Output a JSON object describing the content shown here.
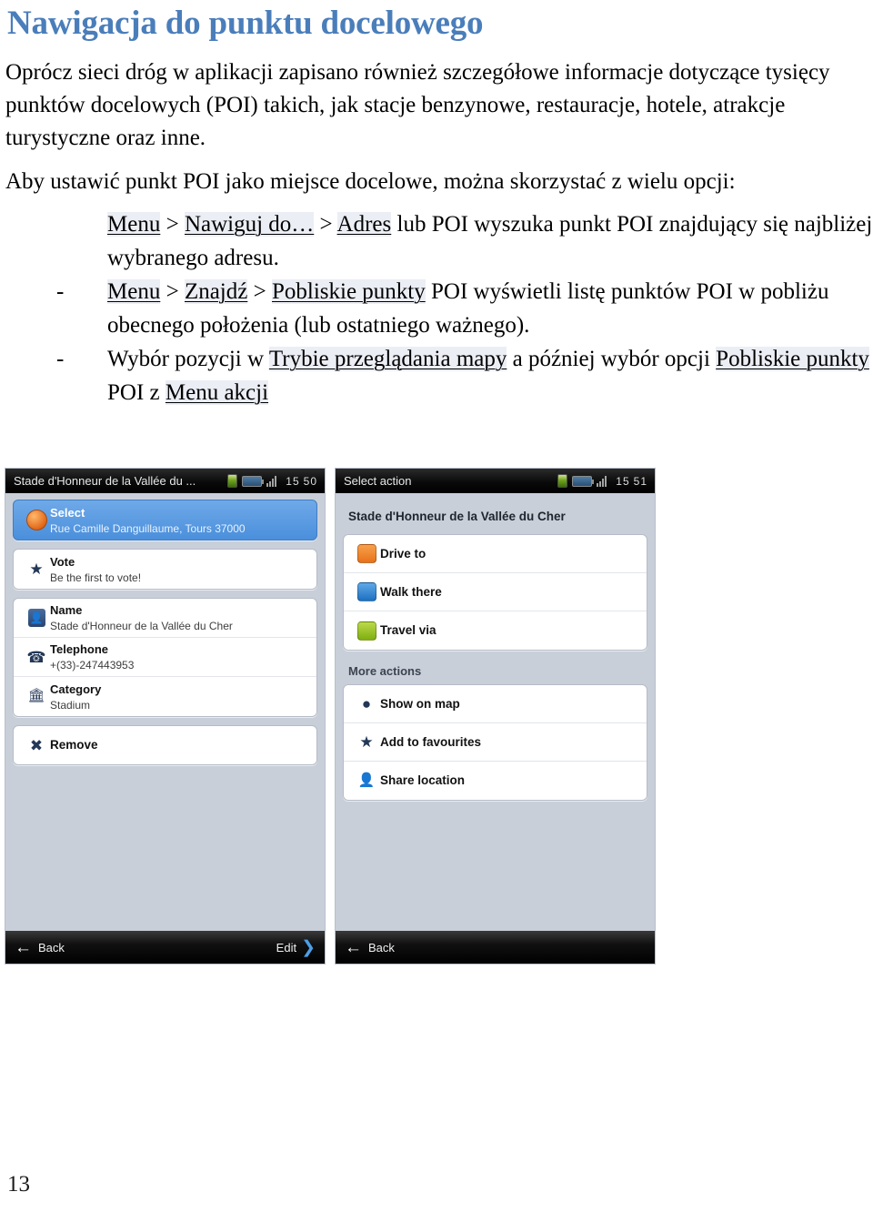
{
  "document": {
    "title": "Nawigacja do punktu docelowego",
    "title_color": "#4a7ebb",
    "paragraphs": [
      "Oprócz sieci dróg w aplikacji zapisano również szczegółowe informacje dotyczące tysięcy punktów docelowych (POI) takich, jak stacje benzynowe, restauracje, hotele, atrakcje turystyczne oraz inne.",
      "Aby ustawić punkt POI jako miejsce docelowe, można skorzystać z wielu opcji:"
    ],
    "bullets": [
      {
        "dash": "",
        "segments": [
          {
            "text": "Menu",
            "link": true
          },
          {
            "text": " > ",
            "link": false
          },
          {
            "text": "Nawiguj do…",
            "link": true
          },
          {
            "text": " > ",
            "link": false
          },
          {
            "text": "Adres",
            "link": true
          },
          {
            "text": " lub POI wyszuka punkt POI znajdujący się najbliżej wybranego adresu.",
            "link": false
          }
        ]
      },
      {
        "dash": "-",
        "segments": [
          {
            "text": "Menu",
            "link": true
          },
          {
            "text": " > ",
            "link": false
          },
          {
            "text": "Znajdź",
            "link": true
          },
          {
            "text": " > ",
            "link": false
          },
          {
            "text": "Pobliskie punkty",
            "link": true
          },
          {
            "text": " POI wyświetli listę punktów POI w pobliżu obecnego położenia (lub ostatniego ważnego).",
            "link": false
          }
        ]
      },
      {
        "dash": "-",
        "segments": [
          {
            "text": "Wybór pozycji w ",
            "link": false
          },
          {
            "text": "Trybie przeglądania mapy",
            "link": true
          },
          {
            "text": " a później wybór opcji ",
            "link": false
          },
          {
            "text": "Pobliskie punkty",
            "link": true
          },
          {
            "text": " POI z ",
            "link": false
          },
          {
            "text": "Menu akcji",
            "link": true
          }
        ]
      }
    ],
    "folio": "13"
  },
  "screenshot_left": {
    "statusbar": {
      "title": "Stade d'Honneur de la Vallée du ...",
      "gps_icon": "gps-icon",
      "battery_icon": "battery-icon",
      "signal_icon": "signal-bars-icon",
      "time_hours": "15",
      "time_minutes": "50"
    },
    "rows": [
      {
        "icon": "poi-marker-icon",
        "title": "Select",
        "subtitle": "Rue Camille Danguillaume,  Tours 37000",
        "selected": true
      },
      {
        "icon": "star-icon",
        "title": "Vote",
        "subtitle": "Be the first to vote!",
        "selected": false
      },
      {
        "icon": "name-badge-icon",
        "title": "Name",
        "subtitle": "Stade d'Honneur de la Vallée du Cher",
        "selected": false
      },
      {
        "icon": "telephone-icon",
        "title": "Telephone",
        "subtitle": "+(33)-247443953",
        "selected": false
      },
      {
        "icon": "category-icon",
        "title": "Category",
        "subtitle": "Stadium",
        "selected": false
      }
    ],
    "remove_row": {
      "icon": "remove-x-icon",
      "title": "Remove"
    },
    "bottombar": {
      "back_label": "Back",
      "back_icon": "arrow-left-icon",
      "edit_label": "Edit",
      "edit_icon": "arrow-right-icon"
    }
  },
  "screenshot_right": {
    "statusbar": {
      "title": "Select action",
      "gps_icon": "gps-icon",
      "battery_icon": "battery-icon",
      "signal_icon": "signal-bars-icon",
      "time_hours": "15",
      "time_minutes": "51"
    },
    "poi_name": "Stade d'Honneur de la Vallée du Cher",
    "primary_actions": [
      {
        "icon": "drive-to-icon",
        "label": "Drive to"
      },
      {
        "icon": "walk-there-icon",
        "label": "Walk there"
      },
      {
        "icon": "travel-via-icon",
        "label": "Travel via"
      }
    ],
    "more_actions_header": "More actions",
    "more_actions": [
      {
        "icon": "show-on-map-icon",
        "label": "Show on map"
      },
      {
        "icon": "star-icon",
        "label": "Add to favourites"
      },
      {
        "icon": "share-location-icon",
        "label": "Share location"
      }
    ],
    "bottombar": {
      "back_label": "Back",
      "back_icon": "arrow-left-icon"
    }
  }
}
